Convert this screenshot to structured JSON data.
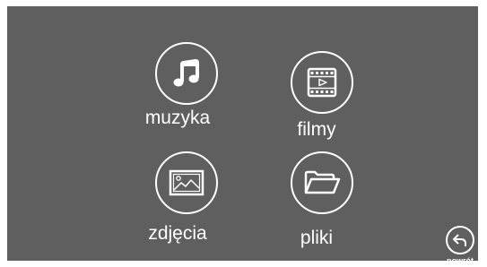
{
  "colors": {
    "panel_background": "#5f5f5f",
    "foreground": "#ffffff",
    "page_background": "#ffffff"
  },
  "menu": {
    "music": {
      "label": "muzyka",
      "icon": "music-note-icon"
    },
    "movies": {
      "label": "filmy",
      "icon": "film-strip-icon"
    },
    "photos": {
      "label": "zdjęcia",
      "icon": "picture-icon"
    },
    "files": {
      "label": "pliki",
      "icon": "folder-icon"
    }
  },
  "back": {
    "label": "powrót",
    "icon": "back-arrow-icon"
  }
}
